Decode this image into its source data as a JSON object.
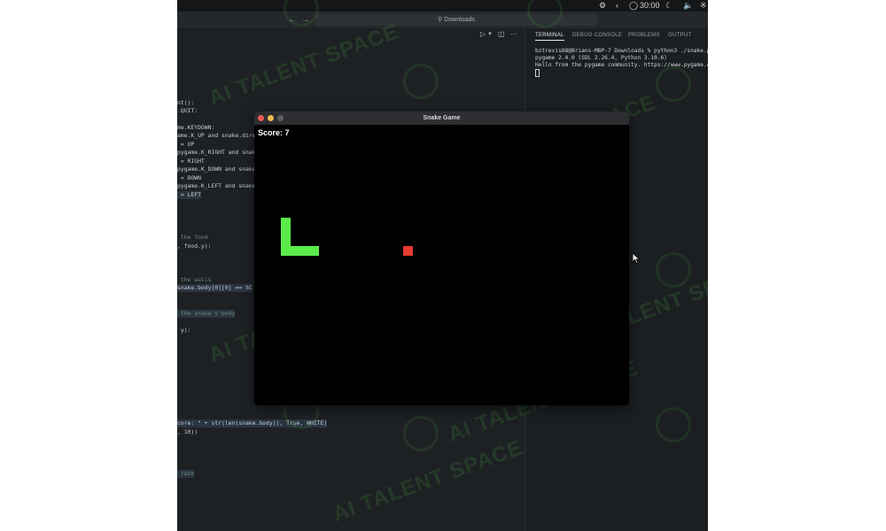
{
  "menubar": {
    "time": "30:00"
  },
  "titlebar": {
    "search_label": "Downloads"
  },
  "editor_toolbar": {
    "more_label": "···"
  },
  "editor": {
    "lines": [
      {
        "text": "nt():"
      },
      {
        "text": ".QUIT:"
      },
      {
        "text": "me.KEYDOWN:"
      },
      {
        "text": "ame.K_UP and snake.dire"
      },
      {
        "text": " = UP"
      },
      {
        "text": "pygame.K_RIGHT and snake"
      },
      {
        "text": " = RIGHT"
      },
      {
        "text": "pygame.K_DOWN and snake."
      },
      {
        "text": " = DOWN"
      },
      {
        "text": "pygame.K_LEFT and snake."
      },
      {
        "text": " = LEFT"
      },
      {
        "text": " the food"
      },
      {
        "text": ", food.y):"
      },
      {
        "text": " the walls"
      },
      {
        "text": "snake.body[0][0] == SC"
      },
      {
        "text": " the snake's body"
      },
      {
        "text": " y):"
      },
      {
        "text": "core: \" + str(len(snake.body)), True, WHITE)"
      },
      {
        "text": ", 10))"
      },
      {
        "text": " rate"
      }
    ]
  },
  "panel": {
    "tabs": [
      "TERMINAL",
      "DEBUG CONSOLE",
      "PROBLEMS",
      "OUTPUT"
    ],
    "active_tab": "TERMINAL",
    "terminal_lines": [
      "bztrevis88@Brians-MBP-7 Downloads % python3 ./snake.p",
      "pygame 2.4.0 (SDL 2.26.4, Python 3.10.6)",
      "Hello from the pygame community. https://www.pygame.o"
    ]
  },
  "game_window": {
    "title": "Snake Game",
    "score_text": "Score: 7",
    "snake_color": "#5aeb4a",
    "food_color": "#e53b2c",
    "background": "#000000"
  },
  "watermark": {
    "text": "AI TALENT SPACE"
  }
}
